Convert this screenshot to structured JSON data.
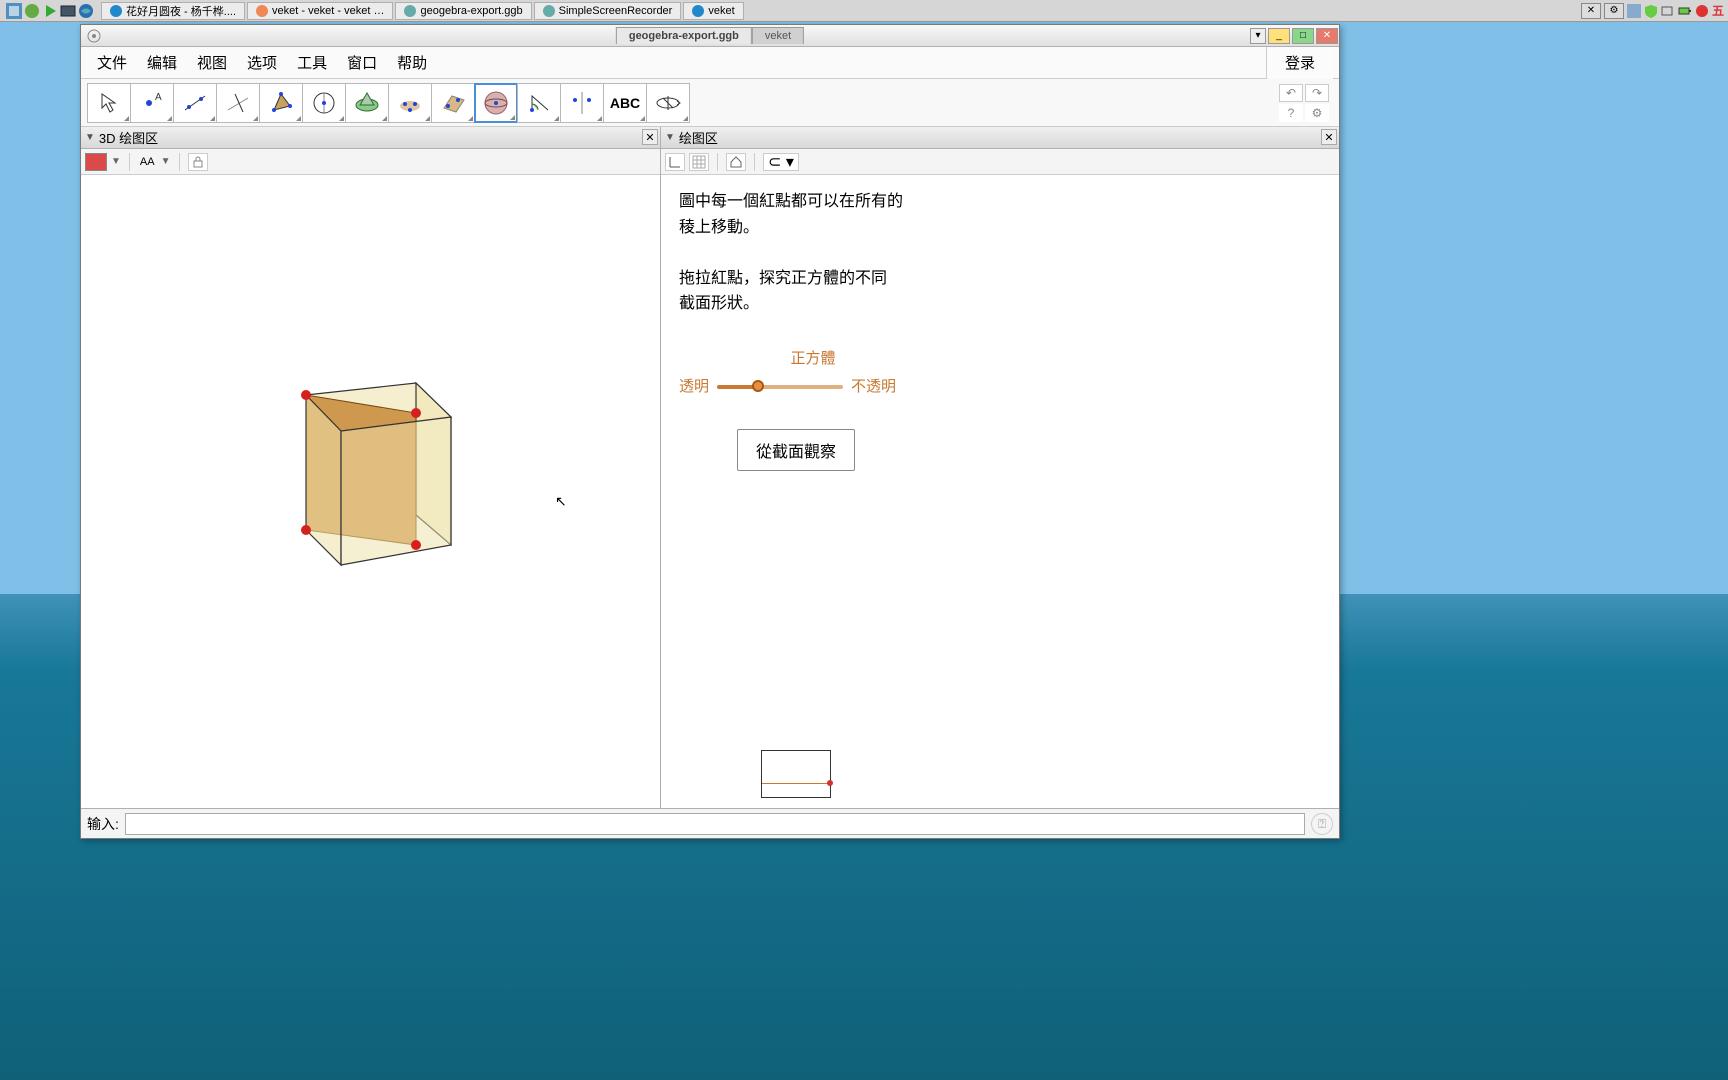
{
  "taskbar": {
    "items": [
      {
        "label": "花好月圆夜 - 杨千桦...."
      },
      {
        "label": "veket - veket - veket …"
      },
      {
        "label": "geogebra-export.ggb"
      },
      {
        "label": "SimpleScreenRecorder"
      },
      {
        "label": "veket"
      }
    ],
    "ime": "五"
  },
  "window": {
    "title_tabs": [
      "geogebra-export.ggb",
      "veket"
    ]
  },
  "menu": {
    "file": "文件",
    "edit": "编辑",
    "view": "视图",
    "options": "选项",
    "tools": "工具",
    "window": "窗口",
    "help": "帮助",
    "login": "登录"
  },
  "toolbar": {
    "abc": "ABC"
  },
  "panels": {
    "p3d": "3D 绘图区",
    "p2d": "绘图区"
  },
  "subtool": {
    "aa": "AA"
  },
  "text": {
    "l1": "圖中每一個紅點都可以在所有的",
    "l2": "稜上移動。",
    "l3": "拖拉紅點，探究正方體的不同",
    "l4": "截面形狀。"
  },
  "slider": {
    "title": "正方體",
    "left": "透明",
    "right": "不透明",
    "value": 0.28
  },
  "button": {
    "section": "從截面觀察"
  },
  "input": {
    "label": "输入:",
    "placeholder": ""
  },
  "chart_data": {
    "type": "3d-model",
    "description": "Translucent yellow cube with internal orange cross-section plane; four red draggable vertices on edges",
    "slider_opacity": 0.28
  }
}
